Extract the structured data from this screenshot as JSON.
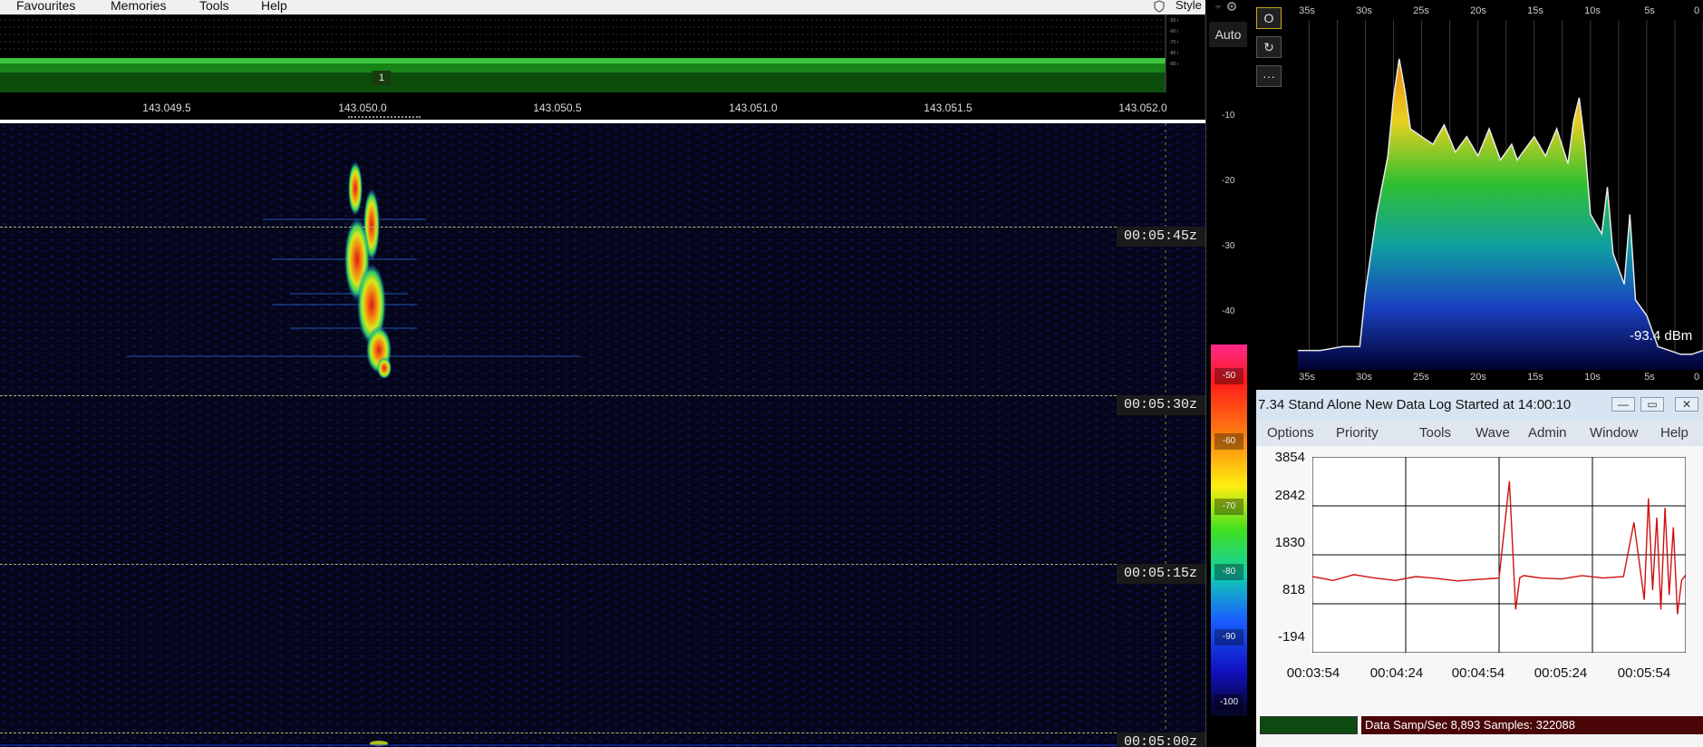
{
  "menubar": {
    "items": [
      "Favourites",
      "Memories",
      "Tools",
      "Help"
    ],
    "style_label": "Style"
  },
  "spectrum": {
    "marker_label": "1",
    "freq_labels": [
      "143.049.5",
      "143.050.0",
      "143.050.5",
      "143.051.0",
      "143.051.5",
      "143.052.0"
    ]
  },
  "waterfall": {
    "time_labels": [
      "00:05:45z",
      "00:05:30z",
      "00:05:15z",
      "00:05:00z"
    ]
  },
  "scale": {
    "auto_label": "Auto",
    "ticks": [
      "-10",
      "-20",
      "-30",
      "-40"
    ],
    "bar_ticks": [
      "-50",
      "-60",
      "-70",
      "-80",
      "-90",
      "-100"
    ]
  },
  "history": {
    "tool_buttons": [
      "O",
      "↻",
      "···"
    ],
    "time_ticks": [
      "35s",
      "30s",
      "25s",
      "20s",
      "15s",
      "10s",
      "5s",
      "0"
    ],
    "readout": "-93.4 dBm"
  },
  "logger": {
    "title": "7.34  Stand Alone  New Data Log Started at 14:00:10",
    "window_buttons": [
      "—",
      "▭",
      "✕"
    ],
    "menu": [
      "Options",
      "Priority",
      "Tools",
      "Wave",
      "Admin",
      "Window",
      "Help"
    ],
    "y_labels": [
      "3854",
      "2842",
      "1830",
      "818",
      "-194"
    ],
    "x_labels": [
      "00:03:54",
      "00:04:24",
      "00:04:54",
      "00:05:24",
      "00:05:54"
    ],
    "status_text": "Data Samp/Sec 8,893   Samples:  322088"
  },
  "chart_data": [
    {
      "type": "area",
      "xlabel": "",
      "ylabel": "",
      "x_ticks": [
        "35s",
        "30s",
        "25s",
        "20s",
        "15s",
        "10s",
        "5s",
        "0"
      ],
      "x": [
        36,
        34,
        32,
        30.5,
        30,
        29,
        28,
        27.5,
        27,
        26.5,
        26,
        25,
        24,
        23,
        22,
        21,
        20,
        19,
        18,
        17,
        16.5,
        16,
        15,
        14,
        13,
        12,
        11.5,
        11,
        10.5,
        10,
        9,
        8.5,
        8,
        7,
        6.5,
        6,
        5,
        4,
        3,
        2,
        1,
        0
      ],
      "values": [
        -95,
        -95,
        -94,
        -94,
        -80,
        -60,
        -45,
        -30,
        -20,
        -28,
        -38,
        -40,
        -42,
        -37,
        -44,
        -40,
        -45,
        -38,
        -46,
        -42,
        -46,
        -44,
        -40,
        -45,
        -38,
        -47,
        -36,
        -30,
        -42,
        -60,
        -65,
        -53,
        -70,
        -78,
        -60,
        -82,
        -86,
        -94,
        -95,
        -96,
        -96,
        -95
      ],
      "series": [
        {
          "name": "",
          "values": []
        }
      ],
      "grid": true
    },
    {
      "type": "line",
      "x_labels": [
        "00:03:54",
        "00:04:24",
        "00:04:54",
        "00:05:24",
        "00:05:54"
      ],
      "ylim": [
        -194,
        3854
      ],
      "y_ticks": [
        3854,
        2842,
        1830,
        818,
        -194
      ],
      "x": [
        0,
        10,
        20,
        30,
        40,
        50,
        60,
        70,
        80,
        90,
        95,
        98,
        100,
        102,
        105,
        110,
        120,
        130,
        140,
        150,
        155,
        160,
        162,
        164,
        166,
        168,
        170,
        172,
        174,
        176,
        178,
        180
      ],
      "values": [
        1380,
        1300,
        1420,
        1350,
        1300,
        1380,
        1340,
        1290,
        1320,
        1350,
        3350,
        700,
        1360,
        1400,
        1380,
        1350,
        1330,
        1400,
        1350,
        1380,
        2500,
        900,
        3000,
        1100,
        2600,
        700,
        2800,
        1000,
        2400,
        600,
        1300,
        1420
      ],
      "grid": true
    }
  ]
}
